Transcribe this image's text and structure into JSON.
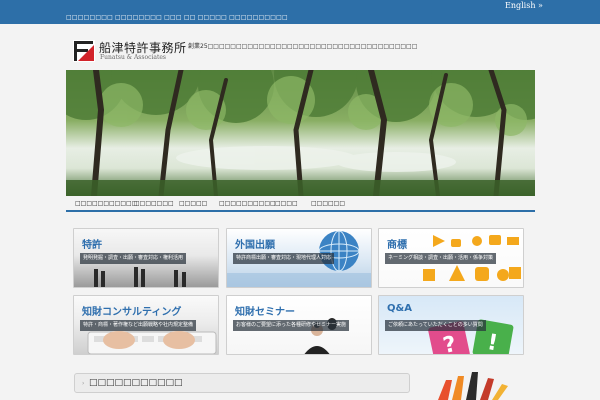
{
  "topbar": {
    "tagline": "□□□□□□□□ □□□□□□□□ □□□ □□ □□□□□ □□□□□□□□□□",
    "language_link": "English »"
  },
  "header": {
    "logo_jp": "船津特許事務所",
    "logo_en": "Funatsu & Associates",
    "description": "創業25□□□□□□□□□□□□□□□□□□□□□□□□□□□□□□□□□□□□□"
  },
  "nav": {
    "items": [
      "□□□□□□□□□□□",
      "□□□□□□□",
      "□□□□□",
      "□□□□□□□□□□",
      "□□□□",
      "□□□□□□"
    ]
  },
  "tiles": [
    {
      "title": "特許",
      "subtitle": "発明発掘・調査・出願・審査対応・権利活用"
    },
    {
      "title": "外国出願",
      "subtitle": "特許商標出願・審査対応・現地代理人対応"
    },
    {
      "title": "商標",
      "subtitle": "ネーミング相談・調査・出願・活用・係争対策"
    },
    {
      "title": "知財コンサルティング",
      "subtitle": "特許・商標・著作権など出願戦略や社内規定整備"
    },
    {
      "title": "知財セミナー",
      "subtitle": "お客様のご要望に添った各種研修やセミナー実施"
    },
    {
      "title": "Q&A",
      "subtitle": "ご依頼にあたっていただくことの多い質問"
    }
  ],
  "news": {
    "label": "□□□□□□□□□□□"
  },
  "colors": {
    "topbar": "#2d6fa8",
    "tile_title": "#2f6fae",
    "logo_red": "#d2232a"
  }
}
